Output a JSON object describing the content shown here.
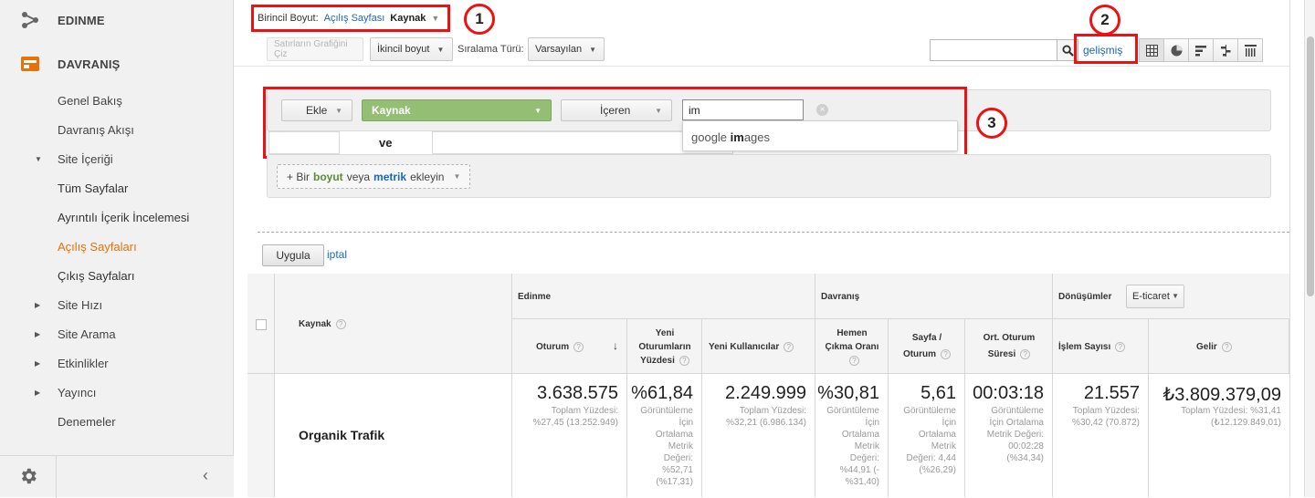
{
  "sidebar": {
    "sections": [
      {
        "label": "EDINME",
        "icon": "acquisition-icon"
      },
      {
        "label": "DAVRANIŞ",
        "icon": "behavior-icon"
      }
    ],
    "items": [
      {
        "label": "Genel Bakış"
      },
      {
        "label": "Davranış Akışı"
      },
      {
        "label": "Site İçeriği"
      },
      {
        "label": "Tüm Sayfalar"
      },
      {
        "label": "Ayrıntılı İçerik İncelemesi"
      },
      {
        "label": "Açılış Sayfaları"
      },
      {
        "label": "Çıkış Sayfaları"
      },
      {
        "label": "Site Hızı"
      },
      {
        "label": "Site Arama"
      },
      {
        "label": "Etkinlikler"
      },
      {
        "label": "Yayıncı"
      },
      {
        "label": "Denemeler"
      }
    ],
    "collapse_label": "‹"
  },
  "toolbar": {
    "primary_dimension_label": "Birincil Boyut:",
    "primary_dimension_option": "Açılış Sayfası",
    "primary_dimension_current": "Kaynak",
    "plot_rows_label": "Satırların Grafiğini Çiz",
    "secondary_dimension_label": "İkincil boyut",
    "sort_type_label": "Sıralama Türü:",
    "sort_type_value": "Varsayılan",
    "search_value": "",
    "advanced_link": "gelişmiş"
  },
  "annotations": {
    "badge1": "1",
    "badge2": "2",
    "badge3": "3",
    "color": "#e11111"
  },
  "filter": {
    "include_label": "Ekle",
    "dimension_label": "Kaynak",
    "match_type_label": "İçeren",
    "input_value": "im",
    "suggestion_prefix": "google ",
    "suggestion_match": "im",
    "suggestion_suffix": "ages",
    "and_label": "ve",
    "add_prefix": "+ Bir",
    "add_dimension": "boyut",
    "add_or": "veya",
    "add_metric": "metrik",
    "add_suffix": "ekleyin",
    "apply_label": "Uygula",
    "cancel_label": "iptal"
  },
  "table": {
    "group_headers": {
      "acquisition": "Edinme",
      "behavior": "Davranış",
      "conversions": "Dönüşümler",
      "conversion_type": "E-ticaret"
    },
    "columns": {
      "source": "Kaynak",
      "sessions": "Oturum",
      "new_sessions_1": "Yeni",
      "new_sessions_2": "Oturumların",
      "new_sessions_3": "Yüzdesi",
      "new_users": "Yeni Kullanıcılar",
      "bounce_1": "Hemen",
      "bounce_2": "Çıkma Oranı",
      "pages_1": "Sayfa /",
      "pages_2": "Oturum",
      "duration_1": "Ort. Oturum",
      "duration_2": "Süresi",
      "transactions": "İşlem Sayısı",
      "revenue": "Gelir"
    },
    "row": {
      "source": "Organik Trafik",
      "sessions": "3.638.575",
      "sessions_note_1": "Toplam Yüzdesi:",
      "sessions_note_2": "%27,45 (13.252.949)",
      "new_sessions": "%61,84",
      "new_sessions_note": [
        "Görüntüleme",
        "İçin",
        "Ortalama",
        "Metrik",
        "Değeri:",
        "%52,71",
        "(%17,31)"
      ],
      "new_users": "2.249.999",
      "new_users_note_1": "Toplam Yüzdesi:",
      "new_users_note_2": "%32,21 (6.986.134)",
      "bounce": "%30,81",
      "bounce_note": [
        "Görüntüleme",
        "İçin",
        "Ortalama",
        "Metrik",
        "Değeri:",
        "%44,91 (-",
        "%31,40)"
      ],
      "pages": "5,61",
      "pages_note": [
        "Görüntüleme",
        "İçin",
        "Ortalama",
        "Metrik",
        "Değeri: 4,44",
        "(%26,29)"
      ],
      "duration": "00:03:18",
      "duration_note": [
        "Görüntüleme",
        "İçin Ortalama",
        "Metrik Değeri:",
        "00:02:28",
        "(%34,34)"
      ],
      "transactions": "21.557",
      "transactions_note_1": "Toplam Yüzdesi:",
      "transactions_note_2": "%30,42 (70.872)",
      "revenue": "₺3.809.379,09",
      "revenue_note_1": "Toplam Yüzdesi: %31,41",
      "revenue_note_2": "(₺12.129.849,01)"
    }
  }
}
